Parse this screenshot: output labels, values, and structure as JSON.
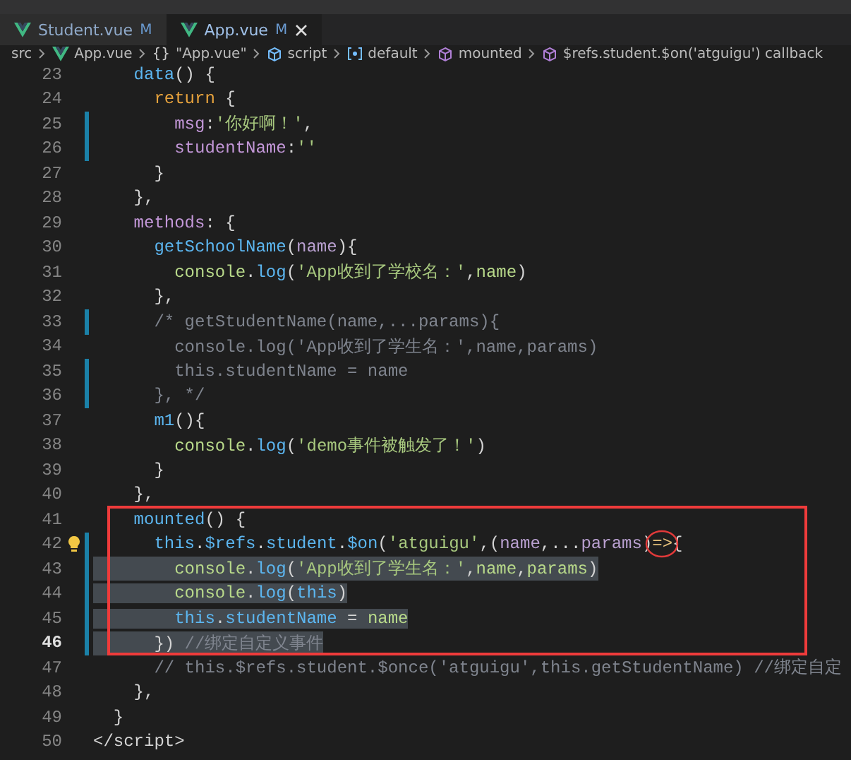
{
  "tabs": [
    {
      "label": "Student.vue",
      "status": "M",
      "selected": false
    },
    {
      "label": "App.vue",
      "status": "M",
      "selected": true
    }
  ],
  "breadcrumb": [
    {
      "kind": "plain",
      "label": "src"
    },
    {
      "kind": "vue",
      "label": "App.vue"
    },
    {
      "kind": "braces",
      "icon": "{}",
      "label": "\"App.vue\""
    },
    {
      "kind": "script",
      "label": "script"
    },
    {
      "kind": "default",
      "label": "default"
    },
    {
      "kind": "method",
      "label": "mounted"
    },
    {
      "kind": "method",
      "label": "$refs.student.$on('atguigu') callback"
    }
  ],
  "lines": [
    {
      "number": "23",
      "modified": false,
      "current": false,
      "selected": false,
      "bulb": false,
      "tokens": [
        {
          "text": "    data",
          "kind": "fn"
        },
        {
          "text": "() {",
          "kind": "plain"
        }
      ]
    },
    {
      "number": "24",
      "modified": false,
      "current": false,
      "selected": false,
      "bulb": false,
      "tokens": [
        {
          "text": "      return",
          "kind": "kw"
        },
        {
          "text": " {",
          "kind": "plain"
        }
      ]
    },
    {
      "number": "25",
      "modified": true,
      "current": false,
      "selected": false,
      "bulb": false,
      "tokens": [
        {
          "text": "        msg",
          "kind": "prop"
        },
        {
          "text": ":",
          "kind": "plain"
        },
        {
          "text": "'你好啊！'",
          "kind": "str"
        },
        {
          "text": ",",
          "kind": "plain"
        }
      ]
    },
    {
      "number": "26",
      "modified": true,
      "current": false,
      "selected": false,
      "bulb": false,
      "tokens": [
        {
          "text": "        studentName",
          "kind": "prop"
        },
        {
          "text": ":",
          "kind": "plain"
        },
        {
          "text": "''",
          "kind": "str"
        }
      ]
    },
    {
      "number": "27",
      "modified": false,
      "current": false,
      "selected": false,
      "bulb": false,
      "tokens": [
        {
          "text": "      }",
          "kind": "plain"
        }
      ]
    },
    {
      "number": "28",
      "modified": false,
      "current": false,
      "selected": false,
      "bulb": false,
      "tokens": [
        {
          "text": "    },",
          "kind": "plain"
        }
      ]
    },
    {
      "number": "29",
      "modified": false,
      "current": false,
      "selected": false,
      "bulb": false,
      "tokens": [
        {
          "text": "    methods",
          "kind": "prop"
        },
        {
          "text": ": {",
          "kind": "plain"
        }
      ]
    },
    {
      "number": "30",
      "modified": false,
      "current": false,
      "selected": false,
      "bulb": false,
      "tokens": [
        {
          "text": "      getSchoolName",
          "kind": "fn"
        },
        {
          "text": "(",
          "kind": "plain"
        },
        {
          "text": "name",
          "kind": "param"
        },
        {
          "text": "){",
          "kind": "plain"
        }
      ]
    },
    {
      "number": "31",
      "modified": false,
      "current": false,
      "selected": false,
      "bulb": false,
      "tokens": [
        {
          "text": "        console",
          "kind": "var"
        },
        {
          "text": ".",
          "kind": "plain"
        },
        {
          "text": "log",
          "kind": "fn"
        },
        {
          "text": "(",
          "kind": "plain"
        },
        {
          "text": "'App收到了学校名：'",
          "kind": "str"
        },
        {
          "text": ",",
          "kind": "plain"
        },
        {
          "text": "name",
          "kind": "var"
        },
        {
          "text": ")",
          "kind": "plain"
        }
      ]
    },
    {
      "number": "32",
      "modified": false,
      "current": false,
      "selected": false,
      "bulb": false,
      "tokens": [
        {
          "text": "      },",
          "kind": "plain"
        }
      ]
    },
    {
      "number": "33",
      "modified": true,
      "current": false,
      "selected": false,
      "bulb": false,
      "tokens": [
        {
          "text": "      /* getStudentName(name,...params){",
          "kind": "comment"
        }
      ]
    },
    {
      "number": "34",
      "modified": false,
      "current": false,
      "selected": false,
      "bulb": false,
      "tokens": [
        {
          "text": "        console.log('App收到了学生名：',name,params)",
          "kind": "comment"
        }
      ]
    },
    {
      "number": "35",
      "modified": true,
      "current": false,
      "selected": false,
      "bulb": false,
      "tokens": [
        {
          "text": "        this.studentName = name",
          "kind": "comment"
        }
      ]
    },
    {
      "number": "36",
      "modified": true,
      "current": false,
      "selected": false,
      "bulb": false,
      "tokens": [
        {
          "text": "      }, */",
          "kind": "comment"
        }
      ]
    },
    {
      "number": "37",
      "modified": false,
      "current": false,
      "selected": false,
      "bulb": false,
      "tokens": [
        {
          "text": "      m1",
          "kind": "fn"
        },
        {
          "text": "(){",
          "kind": "plain"
        }
      ]
    },
    {
      "number": "38",
      "modified": false,
      "current": false,
      "selected": false,
      "bulb": false,
      "tokens": [
        {
          "text": "        console",
          "kind": "var"
        },
        {
          "text": ".",
          "kind": "plain"
        },
        {
          "text": "log",
          "kind": "fn"
        },
        {
          "text": "(",
          "kind": "plain"
        },
        {
          "text": "'demo事件被触发了！'",
          "kind": "str"
        },
        {
          "text": ")",
          "kind": "plain"
        }
      ]
    },
    {
      "number": "39",
      "modified": false,
      "current": false,
      "selected": false,
      "bulb": false,
      "tokens": [
        {
          "text": "      }",
          "kind": "plain"
        }
      ]
    },
    {
      "number": "40",
      "modified": false,
      "current": false,
      "selected": false,
      "bulb": false,
      "tokens": [
        {
          "text": "    },",
          "kind": "plain"
        }
      ]
    },
    {
      "number": "41",
      "modified": false,
      "current": false,
      "selected": false,
      "bulb": false,
      "tokens": [
        {
          "text": "    mounted",
          "kind": "fn"
        },
        {
          "text": "() {",
          "kind": "plain"
        }
      ]
    },
    {
      "number": "42",
      "modified": true,
      "current": false,
      "selected": false,
      "bulb": true,
      "tokens": [
        {
          "text": "      this",
          "kind": "fn"
        },
        {
          "text": ".",
          "kind": "plain"
        },
        {
          "text": "$refs",
          "kind": "fn"
        },
        {
          "text": ".",
          "kind": "plain"
        },
        {
          "text": "student",
          "kind": "fn"
        },
        {
          "text": ".",
          "kind": "plain"
        },
        {
          "text": "$on",
          "kind": "fn"
        },
        {
          "text": "(",
          "kind": "plain"
        },
        {
          "text": "'atguigu'",
          "kind": "str"
        },
        {
          "text": ",(",
          "kind": "plain"
        },
        {
          "text": "name",
          "kind": "param"
        },
        {
          "text": ",...",
          "kind": "plain"
        },
        {
          "text": "params",
          "kind": "param"
        },
        {
          "text": ")",
          "kind": "plain"
        },
        {
          "text": "=>",
          "kind": "circled"
        },
        {
          "text": "{",
          "kind": "plain"
        }
      ]
    },
    {
      "number": "43",
      "modified": true,
      "current": false,
      "selected": true,
      "bulb": false,
      "tokens": [
        {
          "text": "        console",
          "kind": "var"
        },
        {
          "text": ".",
          "kind": "plain"
        },
        {
          "text": "log",
          "kind": "fn"
        },
        {
          "text": "(",
          "kind": "plain"
        },
        {
          "text": "'App收到了学生名：'",
          "kind": "str"
        },
        {
          "text": ",",
          "kind": "plain"
        },
        {
          "text": "name",
          "kind": "var"
        },
        {
          "text": ",",
          "kind": "plain"
        },
        {
          "text": "params",
          "kind": "var"
        },
        {
          "text": ")",
          "kind": "plain"
        }
      ]
    },
    {
      "number": "44",
      "modified": true,
      "current": false,
      "selected": true,
      "bulb": false,
      "tokens": [
        {
          "text": "        console",
          "kind": "var"
        },
        {
          "text": ".",
          "kind": "plain"
        },
        {
          "text": "log",
          "kind": "fn"
        },
        {
          "text": "(",
          "kind": "plain"
        },
        {
          "text": "this",
          "kind": "fn"
        },
        {
          "text": ")",
          "kind": "plain"
        }
      ]
    },
    {
      "number": "45",
      "modified": true,
      "current": false,
      "selected": true,
      "bulb": false,
      "tokens": [
        {
          "text": "        this",
          "kind": "fn"
        },
        {
          "text": ".",
          "kind": "plain"
        },
        {
          "text": "studentName",
          "kind": "fn"
        },
        {
          "text": " = ",
          "kind": "plain"
        },
        {
          "text": "name",
          "kind": "var"
        }
      ]
    },
    {
      "number": "46",
      "modified": true,
      "current": true,
      "selected": true,
      "bulb": false,
      "tokens": [
        {
          "text": "      })",
          "kind": "plain"
        },
        {
          "text": " //绑定自定义事件",
          "kind": "comment"
        }
      ]
    },
    {
      "number": "47",
      "modified": false,
      "current": false,
      "selected": false,
      "bulb": false,
      "tokens": [
        {
          "text": "      // this.$refs.student.$once('atguigu',this.getStudentName) //绑定自定",
          "kind": "comment"
        }
      ]
    },
    {
      "number": "48",
      "modified": false,
      "current": false,
      "selected": false,
      "bulb": false,
      "tokens": [
        {
          "text": "    },",
          "kind": "plain"
        }
      ]
    },
    {
      "number": "49",
      "modified": false,
      "current": false,
      "selected": false,
      "bulb": false,
      "tokens": [
        {
          "text": "  }",
          "kind": "plain"
        }
      ]
    },
    {
      "number": "50",
      "modified": false,
      "current": false,
      "selected": false,
      "bulb": false,
      "tokens": [
        {
          "text": "</",
          "kind": "plain"
        },
        {
          "text": "script",
          "kind": "tag"
        },
        {
          "text": ">",
          "kind": "plain"
        }
      ]
    }
  ]
}
